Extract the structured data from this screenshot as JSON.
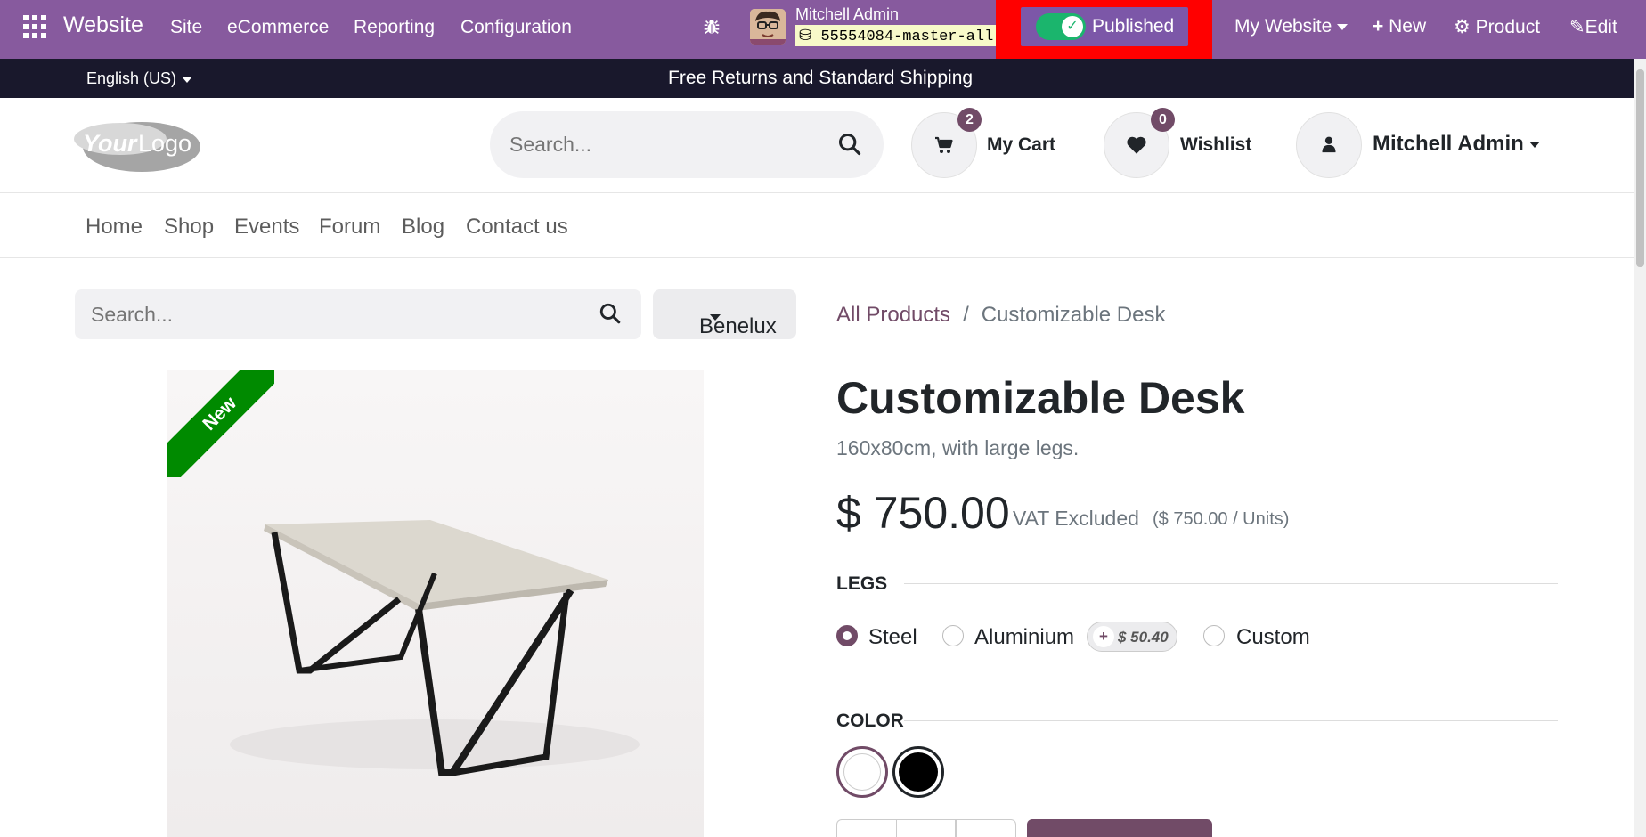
{
  "admin_bar": {
    "app_name": "Website",
    "menus": [
      "Site",
      "eCommerce",
      "Reporting",
      "Configuration"
    ],
    "user_name": "Mitchell Admin",
    "database": "55554084-master-all",
    "publish_toggle": {
      "label": "Published",
      "checked": true
    },
    "right_menu": {
      "website_switcher": "My Website",
      "new": "New",
      "product": "Product",
      "edit": "Edit"
    }
  },
  "announcement": {
    "language": "English (US)",
    "message": "Free Returns and Standard Shipping"
  },
  "header": {
    "search_placeholder": "Search...",
    "cart": {
      "label": "My Cart",
      "count": "2"
    },
    "wishlist": {
      "label": "Wishlist",
      "count": "0"
    },
    "account": {
      "label": "Mitchell Admin"
    }
  },
  "nav": {
    "items": [
      "Home",
      "Shop",
      "Events",
      "Forum",
      "Blog",
      "Contact us"
    ]
  },
  "product_toolbar": {
    "search_placeholder": "Search...",
    "pricelist": "Benelux"
  },
  "breadcrumb": {
    "parent": "All Products",
    "separator": "/",
    "current": "Customizable Desk"
  },
  "product": {
    "ribbon": "New",
    "name": "Customizable Desk",
    "description": "160x80cm, with large legs.",
    "price": "$ 750.00",
    "tax_note": "VAT Excluded",
    "unit_price": "($ 750.00 / Units)",
    "attributes": {
      "legs": {
        "title": "LEGS",
        "options": [
          {
            "label": "Steel",
            "selected": true
          },
          {
            "label": "Aluminium",
            "selected": false,
            "extra_sign": "+",
            "extra_price": "$ 50.40"
          },
          {
            "label": "Custom",
            "selected": false
          }
        ]
      },
      "color": {
        "title": "COLOR",
        "options": [
          {
            "name": "White",
            "hex": "#ffffff",
            "selected": true
          },
          {
            "name": "Black",
            "hex": "#000000",
            "selected": false
          }
        ]
      }
    }
  },
  "colors": {
    "admin_bar": "#875a9e",
    "publish_highlight": "#ff0000",
    "toggle_on": "#1bb56d",
    "brand": "#714b67",
    "announcement_bg": "#19182c",
    "ribbon": "#008a00"
  },
  "icons": [
    "apps-grid-icon",
    "bug-icon",
    "database-icon",
    "check-icon",
    "plus-icon",
    "gear-icon",
    "pencil-icon",
    "search-icon",
    "cart-icon",
    "heart-icon",
    "user-icon",
    "caret-down-icon"
  ]
}
